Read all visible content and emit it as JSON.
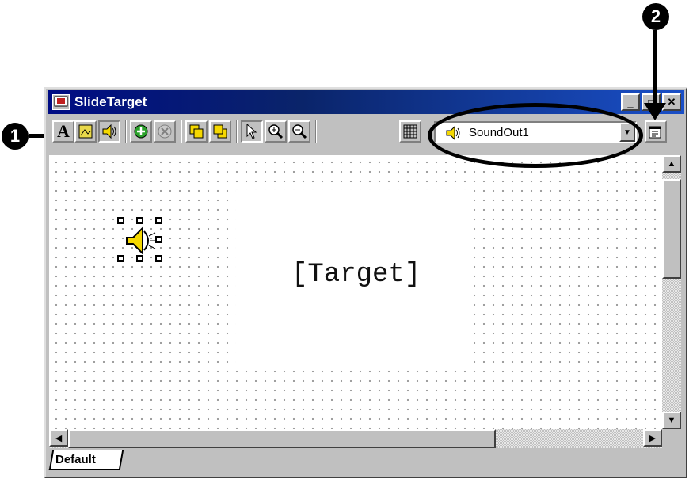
{
  "window": {
    "title": "SlideTarget",
    "controls": {
      "minimize": "_",
      "maximize": "□",
      "close": "✕"
    }
  },
  "toolbar": {
    "text_tool_label": "A",
    "sound_selector": {
      "selected": "SoundOut1"
    }
  },
  "canvas": {
    "target_label": "[Target]"
  },
  "tabs": [
    {
      "label": "Default"
    }
  ],
  "annotations": {
    "callout_1": "1",
    "callout_2": "2"
  },
  "colors": {
    "titlebar": "#0a246a",
    "chrome": "#c0c0c0",
    "speaker": "#f5d800"
  }
}
